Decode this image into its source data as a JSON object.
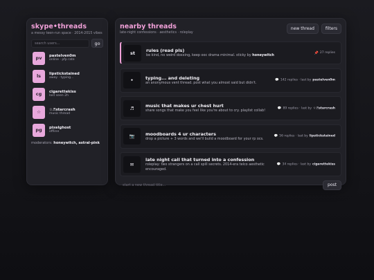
{
  "sidebar": {
    "brand": "skype•threads",
    "tagline": "a messy teen-run space · 2014-2015 vibes",
    "search_placeholder": "search users...",
    "go_label": "go",
    "users": [
      {
        "initials": "pv",
        "name": "pastelven0m",
        "status": "online · pfp rate"
      },
      {
        "initials": "ls",
        "name": "lipstickstained",
        "status": "away · typing..."
      },
      {
        "initials": "cg",
        "name": "cigarettekiss",
        "status": "last seen 2h"
      },
      {
        "initials": "☆",
        "name": "☆♬starcrash",
        "status": "music thread"
      },
      {
        "initials": "pg",
        "name": "pixelghost",
        "status": "offline"
      }
    ],
    "mods_label": "moderators:",
    "mods_names": "honeywitch, astral-pink"
  },
  "main": {
    "title": "nearby threads",
    "subtitle": "late-night confessions · aesthetics · roleplay",
    "new_thread_label": "new thread",
    "filters_label": "filters",
    "threads": [
      {
        "icon": "st",
        "title": "rules (read pls)",
        "desc": "be kind, no weird doxxing, keep ooc drama minimal. sticky by",
        "desc_author": "honeywitch",
        "meta": "27 replies",
        "pinned": true
      },
      {
        "icon": "•",
        "title": "typing... and deleting",
        "desc": "an anonymous vent thread. post what you almost said but didn't.",
        "replies": "142 replies · last by",
        "last_by": "pastelven0m"
      },
      {
        "icon": "♬",
        "title": "music that makes ur chest hurt",
        "desc": "share songs that make you feel like you're about to cry. playlist collab!",
        "replies": "89 replies · last by",
        "last_by": "☆♬starcrash"
      },
      {
        "icon": "📷",
        "title": "moodboards 4 ur characters",
        "desc": "drop a picture + 3 words and we'll build a moodboard for your rp ocs.",
        "replies": "56 replies · last by",
        "last_by": "lipstickstained"
      },
      {
        "icon": "✉",
        "title": "late night call that turned into a confession",
        "desc": "roleplay: two strangers on a call spill secrets. 2014-era telco aesthetic encouraged.",
        "replies": "34 replies · last by",
        "last_by": "cigarettekiss"
      }
    ],
    "composer_placeholder": "start a new thread title...",
    "post_label": "post"
  },
  "colors": {
    "accent": "#f0a0d8",
    "panel": "#212127",
    "background": "#141418"
  }
}
